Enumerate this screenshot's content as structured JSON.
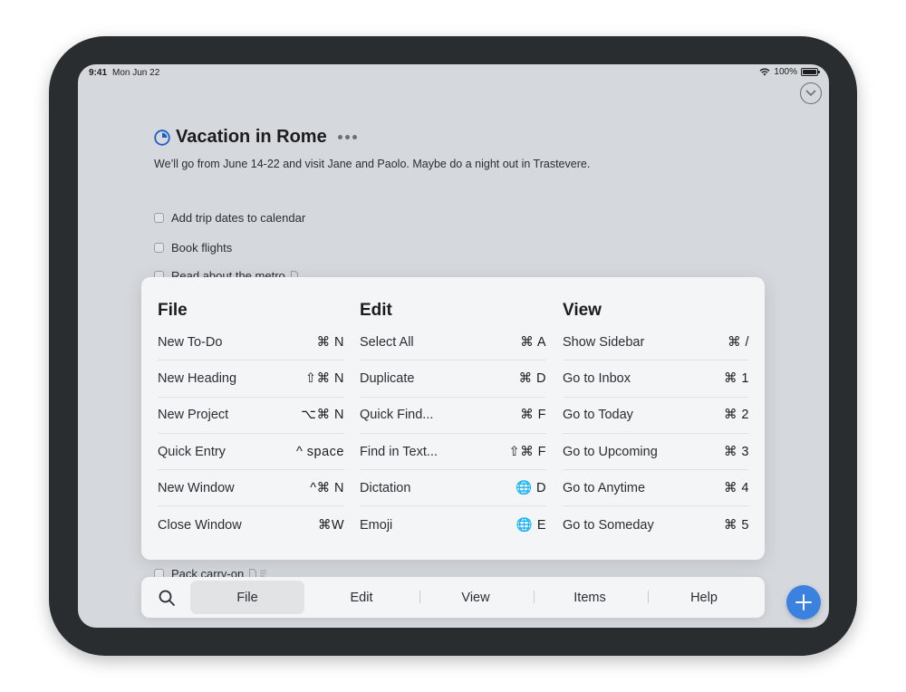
{
  "status_bar": {
    "time": "9:41",
    "date": "Mon Jun 22",
    "battery": "100%"
  },
  "project": {
    "title": "Vacation in Rome",
    "notes": "We’ll go from June 14-22 and visit Jane and Paolo. Maybe do a night out in Trastevere.",
    "todos": [
      {
        "label": "Add trip dates to calendar"
      },
      {
        "label": "Book flights"
      },
      {
        "label": "Read about the metro"
      }
    ],
    "bottom_todo": "Pack carry-on"
  },
  "menu": {
    "file": {
      "title": "File",
      "items": [
        {
          "label": "New To-Do",
          "shortcut": "⌘ N"
        },
        {
          "label": "New Heading",
          "shortcut": "⇧⌘ N"
        },
        {
          "label": "New Project",
          "shortcut": "⌥⌘ N"
        },
        {
          "label": "Quick Entry",
          "shortcut": "^ space"
        },
        {
          "label": "New Window",
          "shortcut": "^⌘ N"
        },
        {
          "label": "Close Window",
          "shortcut": "⌘W"
        }
      ]
    },
    "edit": {
      "title": "Edit",
      "items": [
        {
          "label": "Select All",
          "shortcut": "⌘ A"
        },
        {
          "label": "Duplicate",
          "shortcut": "⌘ D"
        },
        {
          "label": "Quick Find...",
          "shortcut": "⌘ F"
        },
        {
          "label": "Find in Text...",
          "shortcut": "⇧⌘ F"
        },
        {
          "label": "Dictation",
          "shortcut": "🌐 D"
        },
        {
          "label": "Emoji",
          "shortcut": "🌐 E"
        }
      ]
    },
    "view": {
      "title": "View",
      "items": [
        {
          "label": "Show Sidebar",
          "shortcut": "⌘ /"
        },
        {
          "label": "Go to Inbox",
          "shortcut": "⌘ 1"
        },
        {
          "label": "Go to Today",
          "shortcut": "⌘ 2"
        },
        {
          "label": "Go to Upcoming",
          "shortcut": "⌘ 3"
        },
        {
          "label": "Go to Anytime",
          "shortcut": "⌘ 4"
        },
        {
          "label": "Go to Someday",
          "shortcut": "⌘ 5"
        }
      ]
    }
  },
  "menu_bar": {
    "tabs": [
      {
        "label": "File",
        "active": true
      },
      {
        "label": "Edit"
      },
      {
        "label": "View"
      },
      {
        "label": "Items"
      },
      {
        "label": "Help"
      }
    ]
  },
  "colors": {
    "accent": "#3b82e0",
    "project_icon": "#1f5fc4"
  },
  "icons": {
    "search": "magnifier-icon",
    "add": "plus-icon",
    "collapse": "chevron-down-circle-icon"
  }
}
